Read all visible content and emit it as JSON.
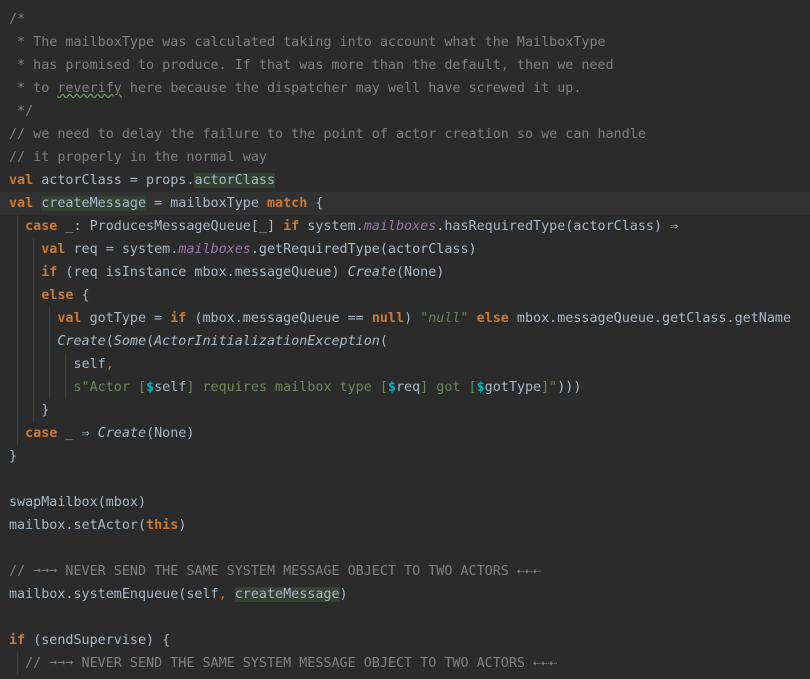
{
  "editor": {
    "colors": {
      "background": "#2b2b2b",
      "text": "#a9b7c6",
      "keyword": "#cc7832",
      "comment": "#808080",
      "field": "#9876aa",
      "string": "#6a8759",
      "interpolation": "#00b5b5",
      "highlight": "#344134",
      "current_line": "#323232"
    },
    "lines": [
      {
        "tokens": [
          {
            "t": "/*",
            "c": "cm"
          }
        ]
      },
      {
        "tokens": [
          {
            "t": " * The mailboxType was calculated taking into account what the MailboxType",
            "c": "cm"
          }
        ]
      },
      {
        "tokens": [
          {
            "t": " * has promised to produce. If that was more than the default, then we need",
            "c": "cm"
          }
        ]
      },
      {
        "tokens": [
          {
            "t": " * to ",
            "c": "cm"
          },
          {
            "t": "reverify",
            "c": "cm squig"
          },
          {
            "t": " here because the dispatcher may well have screwed it up.",
            "c": "cm"
          }
        ]
      },
      {
        "tokens": [
          {
            "t": " */",
            "c": "cm"
          }
        ]
      },
      {
        "tokens": [
          {
            "t": "// we need to delay the failure to the point of actor creation so we can handle",
            "c": "cm"
          }
        ]
      },
      {
        "tokens": [
          {
            "t": "// it properly in the normal way",
            "c": "cm"
          }
        ]
      },
      {
        "tokens": [
          {
            "t": "val",
            "c": "kw"
          },
          {
            "t": " actorClass = props.",
            "c": ""
          },
          {
            "t": "actorClass",
            "c": "hl"
          }
        ]
      },
      {
        "current": true,
        "tokens": [
          {
            "t": "val",
            "c": "kw"
          },
          {
            "t": " ",
            "c": ""
          },
          {
            "t": "createMessage",
            "c": "hl"
          },
          {
            "t": " = mailboxType ",
            "c": ""
          },
          {
            "t": "match",
            "c": "kw"
          },
          {
            "t": " {",
            "c": ""
          }
        ]
      },
      {
        "tokens": [
          {
            "t": "  ",
            "c": ""
          },
          {
            "t": "case",
            "c": "kw"
          },
          {
            "t": " _: ProducesMessageQueue[_] ",
            "c": ""
          },
          {
            "t": "if",
            "c": "kw"
          },
          {
            "t": " system.",
            "c": ""
          },
          {
            "t": "mailboxes",
            "c": "fld"
          },
          {
            "t": ".hasRequiredType(actorClass) ⇒",
            "c": ""
          }
        ]
      },
      {
        "tokens": [
          {
            "t": "    ",
            "c": ""
          },
          {
            "t": "val",
            "c": "kw"
          },
          {
            "t": " req = system.",
            "c": ""
          },
          {
            "t": "mailboxes",
            "c": "fld"
          },
          {
            "t": ".getRequiredType(actorClass)",
            "c": ""
          }
        ]
      },
      {
        "tokens": [
          {
            "t": "    ",
            "c": ""
          },
          {
            "t": "if",
            "c": "kw"
          },
          {
            "t": " (req isInstance mbox.messageQueue) ",
            "c": ""
          },
          {
            "t": "Create",
            "c": "ital"
          },
          {
            "t": "(None)",
            "c": ""
          }
        ]
      },
      {
        "tokens": [
          {
            "t": "    ",
            "c": ""
          },
          {
            "t": "else",
            "c": "kw"
          },
          {
            "t": " {",
            "c": ""
          }
        ]
      },
      {
        "tokens": [
          {
            "t": "      ",
            "c": ""
          },
          {
            "t": "val",
            "c": "kw"
          },
          {
            "t": " gotType = ",
            "c": ""
          },
          {
            "t": "if",
            "c": "kw"
          },
          {
            "t": " (mbox.messageQueue == ",
            "c": ""
          },
          {
            "t": "null",
            "c": "kw"
          },
          {
            "t": ") ",
            "c": ""
          },
          {
            "t": "\"null\"",
            "c": "str ital"
          },
          {
            "t": " ",
            "c": ""
          },
          {
            "t": "else",
            "c": "kw"
          },
          {
            "t": " mbox.messageQueue.getClass.getName",
            "c": ""
          }
        ]
      },
      {
        "tokens": [
          {
            "t": "      ",
            "c": ""
          },
          {
            "t": "Create",
            "c": "ital"
          },
          {
            "t": "(",
            "c": ""
          },
          {
            "t": "Some",
            "c": "ital"
          },
          {
            "t": "(",
            "c": ""
          },
          {
            "t": "ActorInitializationException",
            "c": "ital"
          },
          {
            "t": "(",
            "c": ""
          }
        ]
      },
      {
        "tokens": [
          {
            "t": "        self",
            "c": ""
          },
          {
            "t": ",",
            "c": "esc"
          }
        ]
      },
      {
        "tokens": [
          {
            "t": "        ",
            "c": ""
          },
          {
            "t": "s\"Actor [",
            "c": "str"
          },
          {
            "t": "$",
            "c": "interp"
          },
          {
            "t": "self",
            "c": ""
          },
          {
            "t": "] requires mailbox type [",
            "c": "str"
          },
          {
            "t": "$",
            "c": "interp"
          },
          {
            "t": "req",
            "c": ""
          },
          {
            "t": "] got [",
            "c": "str"
          },
          {
            "t": "$",
            "c": "interp"
          },
          {
            "t": "gotType",
            "c": ""
          },
          {
            "t": "]\"",
            "c": "str"
          },
          {
            "t": ")))",
            "c": ""
          }
        ]
      },
      {
        "tokens": [
          {
            "t": "    }",
            "c": ""
          }
        ]
      },
      {
        "tokens": [
          {
            "t": "  ",
            "c": ""
          },
          {
            "t": "case",
            "c": "kw"
          },
          {
            "t": " _ ⇒ ",
            "c": ""
          },
          {
            "t": "Create",
            "c": "ital"
          },
          {
            "t": "(None)",
            "c": ""
          }
        ]
      },
      {
        "tokens": [
          {
            "t": "}",
            "c": ""
          }
        ]
      },
      {
        "tokens": []
      },
      {
        "tokens": [
          {
            "t": "swapMailbox(mbox)",
            "c": ""
          }
        ]
      },
      {
        "tokens": [
          {
            "t": "mailbox.setActor(",
            "c": ""
          },
          {
            "t": "this",
            "c": "kw"
          },
          {
            "t": ")",
            "c": ""
          }
        ]
      },
      {
        "tokens": []
      },
      {
        "tokens": [
          {
            "t": "// ➞➞➞ NEVER SEND THE SAME SYSTEM MESSAGE OBJECT TO TWO ACTORS ⇠⇠⇠",
            "c": "cm"
          }
        ]
      },
      {
        "tokens": [
          {
            "t": "mailbox.systemEnqueue(self",
            "c": ""
          },
          {
            "t": ",",
            "c": "esc"
          },
          {
            "t": " ",
            "c": ""
          },
          {
            "t": "createMessage",
            "c": "hl"
          },
          {
            "t": ")",
            "c": ""
          }
        ]
      },
      {
        "tokens": []
      },
      {
        "tokens": [
          {
            "t": "if",
            "c": "kw"
          },
          {
            "t": " (sendSupervise) {",
            "c": ""
          }
        ]
      },
      {
        "tokens": [
          {
            "t": "  // ➞➞➞ NEVER SEND THE SAME SYSTEM MESSAGE OBJECT TO TWO ACTORS ⇠⇠⇠",
            "c": "cm"
          }
        ]
      }
    ]
  }
}
